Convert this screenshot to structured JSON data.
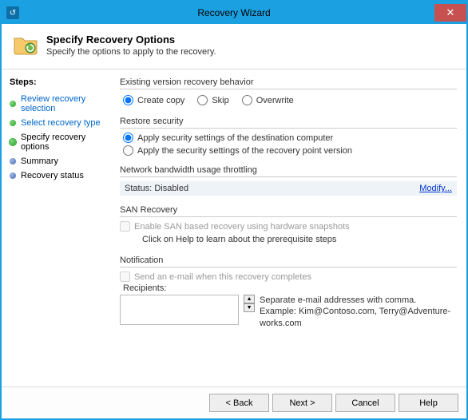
{
  "window": {
    "title": "Recovery Wizard"
  },
  "header": {
    "title": "Specify Recovery Options",
    "subtitle": "Specify the options to apply to the recovery."
  },
  "sidebar": {
    "heading": "Steps:",
    "items": [
      {
        "label": "Review recovery selection",
        "state": "done"
      },
      {
        "label": "Select recovery type",
        "state": "done"
      },
      {
        "label": "Specify recovery options",
        "state": "current"
      },
      {
        "label": "Summary",
        "state": "future"
      },
      {
        "label": "Recovery status",
        "state": "future"
      }
    ]
  },
  "groups": {
    "versionBehavior": {
      "title": "Existing version recovery behavior",
      "options": {
        "createCopy": "Create copy",
        "skip": "Skip",
        "overwrite": "Overwrite"
      },
      "selected": "createCopy"
    },
    "restoreSecurity": {
      "title": "Restore security",
      "options": {
        "dest": "Apply security settings of the destination computer",
        "point": "Apply the security settings of the recovery point version"
      },
      "selected": "dest"
    },
    "throttling": {
      "title": "Network bandwidth usage throttling",
      "statusLabel": "Status:",
      "statusValue": "Disabled",
      "modify": "Modify..."
    },
    "san": {
      "title": "SAN Recovery",
      "checkbox": "Enable SAN based recovery using hardware snapshots",
      "note": "Click on Help to learn about the prerequisite steps"
    },
    "notification": {
      "title": "Notification",
      "checkbox": "Send an e-mail when this recovery completes",
      "recipientsLabel": "Recipients:",
      "hint1": "Separate e-mail addresses with comma.",
      "hint2": "Example: Kim@Contoso.com, Terry@Adventure-works.com"
    }
  },
  "footer": {
    "back": "< Back",
    "next": "Next >",
    "cancel": "Cancel",
    "help": "Help"
  }
}
